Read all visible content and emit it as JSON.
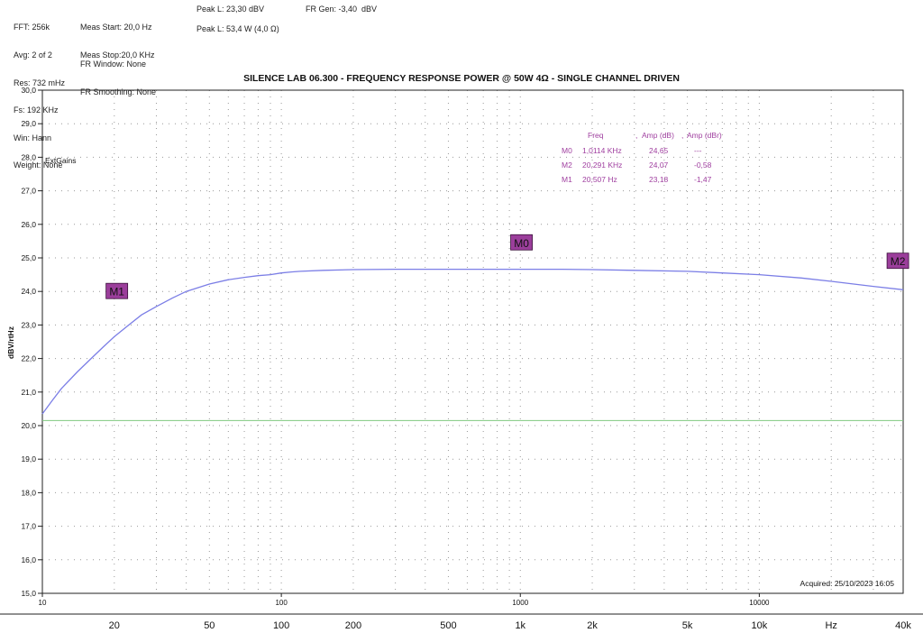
{
  "header": {
    "col1": [
      "FFT: 256k",
      "Avg: 2 of 2",
      "Res: 732 mHz",
      "Fs: 192 KHz",
      "Win: Hann",
      "Weight: None"
    ],
    "col2_top": [
      "Meas Start: 20,0 Hz",
      "Meas Stop:20,0 KHz"
    ],
    "col2_bottom": [
      "FR Window: None",
      "FR Smoothing: None"
    ],
    "col3": [
      "Peak L: 23,30 dBV",
      "Peak L: 53,4 W (4,0 Ω)"
    ],
    "col4": [
      "FR Gen: -3,40  dBV"
    ]
  },
  "chart_data": {
    "type": "line",
    "title": "SILENCE LAB 06.300 - FREQUENCY RESPONSE POWER @ 50W 4Ω - SINGLE CHANNEL DRIVEN",
    "ylabel": "dBV/rtHz",
    "xlabel": "",
    "x_scale": "log",
    "xlim": [
      10,
      40000
    ],
    "ylim": [
      15.0,
      30.0
    ],
    "grid": true,
    "y_ticks": [
      "15,0",
      "16,0",
      "17,0",
      "18,0",
      "19,0",
      "20,0",
      "21,0",
      "22,0",
      "23,0",
      "24,0",
      "25,0",
      "26,0",
      "27,0",
      "28,0",
      "29,0",
      "30,0"
    ],
    "x_ticks_inner": [
      {
        "x": 10,
        "label": "10"
      },
      {
        "x": 100,
        "label": "100"
      },
      {
        "x": 1000,
        "label": "1000"
      },
      {
        "x": 10000,
        "label": "10000"
      }
    ],
    "x_ticks_outer": [
      {
        "x": 20,
        "label": "20"
      },
      {
        "x": 50,
        "label": "50"
      },
      {
        "x": 100,
        "label": "100"
      },
      {
        "x": 200,
        "label": "200"
      },
      {
        "x": 500,
        "label": "500"
      },
      {
        "x": 1000,
        "label": "1k"
      },
      {
        "x": 2000,
        "label": "2k"
      },
      {
        "x": 5000,
        "label": "5k"
      },
      {
        "x": 10000,
        "label": "10k"
      },
      {
        "x": 20000,
        "label": "Hz"
      },
      {
        "x": 40000,
        "label": "40k"
      }
    ],
    "series": [
      {
        "color": "#7b7ee6",
        "x": [
          10,
          11,
          12,
          14,
          16,
          18,
          20,
          23,
          26,
          30,
          35,
          40,
          50,
          60,
          70,
          80,
          90,
          100,
          110,
          120,
          150,
          200,
          300,
          500,
          700,
          1000,
          1500,
          2000,
          3000,
          5000,
          7000,
          10000,
          15000,
          20000,
          30000,
          40000
        ],
        "y": [
          20.35,
          20.75,
          21.1,
          21.6,
          22.0,
          22.35,
          22.65,
          23.0,
          23.3,
          23.55,
          23.8,
          24.0,
          24.22,
          24.35,
          24.42,
          24.47,
          24.5,
          24.55,
          24.58,
          24.6,
          24.63,
          24.65,
          24.66,
          24.66,
          24.66,
          24.66,
          24.66,
          24.65,
          24.63,
          24.6,
          24.55,
          24.5,
          24.4,
          24.3,
          24.15,
          24.05
        ]
      },
      {
        "color": "#7fc97f",
        "x": [
          10,
          40000
        ],
        "y": [
          20.15,
          20.15
        ]
      }
    ],
    "markers": [
      {
        "label": "M0",
        "x": 1011.4,
        "y": 25.45
      },
      {
        "label": "M1",
        "x": 20.5,
        "y": 24.0
      },
      {
        "label": "M2",
        "x": 38000,
        "y": 24.9
      }
    ],
    "marker_color": "#9b3e9b",
    "marker_table": {
      "color": "#a040a0",
      "headers": [
        "Freq",
        "Amp (dB)",
        "Amp (dBr)"
      ],
      "rows": [
        [
          "M0",
          "1,0114 KHz",
          "24,65",
          "---"
        ],
        [
          "M2",
          "20,291 KHz",
          "24,07",
          "-0,58"
        ],
        [
          "M1",
          "20,507 Hz",
          "23,18",
          "-1,47"
        ]
      ]
    },
    "annotations": {
      "ext_gains": "ExtGains",
      "acquired": "Acquired: 25/10/2023  16:05"
    }
  }
}
